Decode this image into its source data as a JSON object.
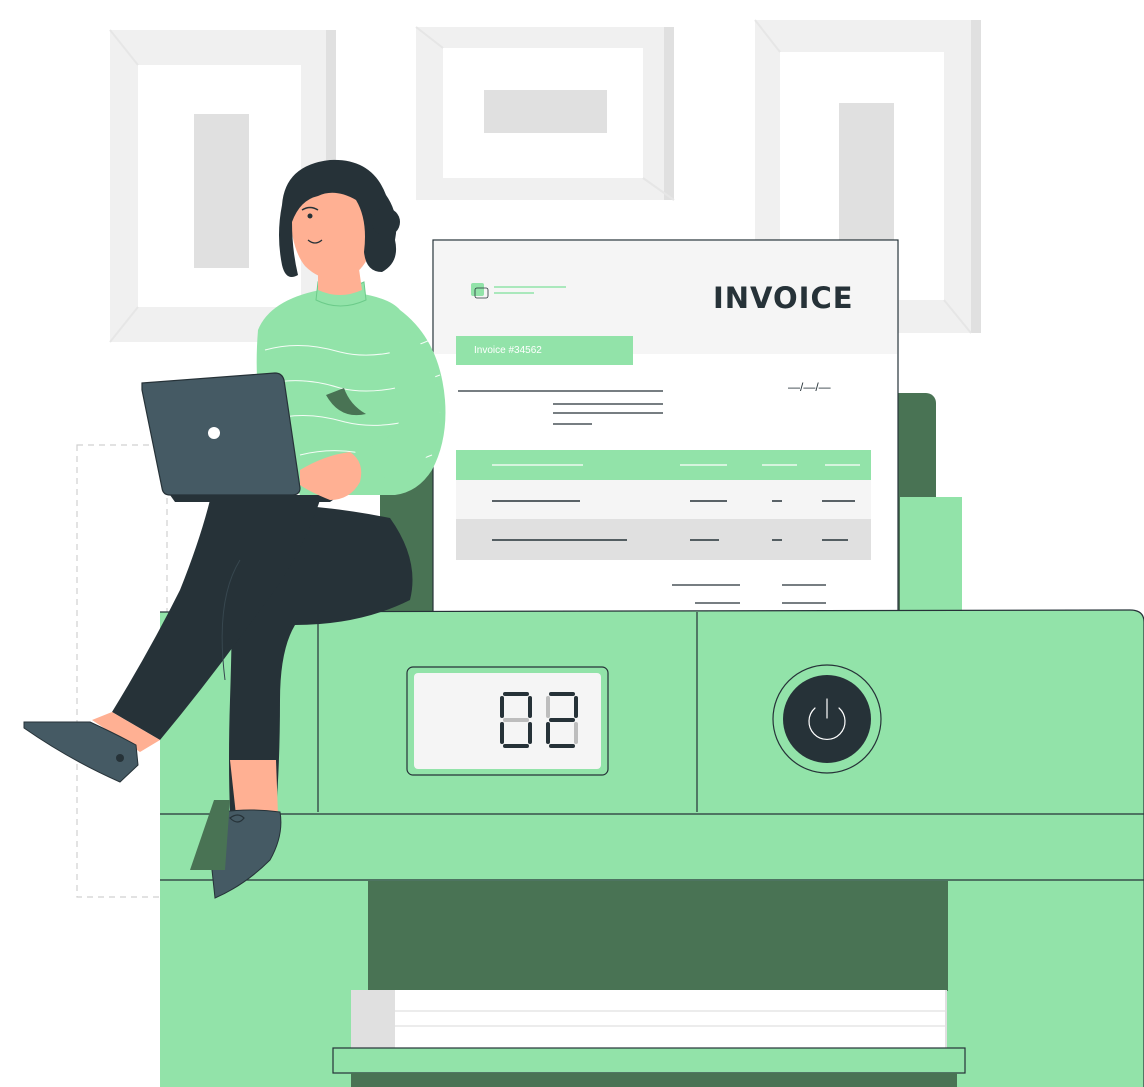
{
  "invoice": {
    "title": "INVOICE",
    "number_label": "Invoice #34562",
    "date_placeholder": "—/—/—"
  },
  "printer": {
    "display_value": "02"
  },
  "colors": {
    "accent_green": "#92E3A9",
    "dark_green": "#497354",
    "dark_ink": "#263238",
    "laptop_gray": "#455A64",
    "frame_gray": "#F0F0F0",
    "frame_inner": "#E0E0E0",
    "skin": "#FFB093"
  }
}
